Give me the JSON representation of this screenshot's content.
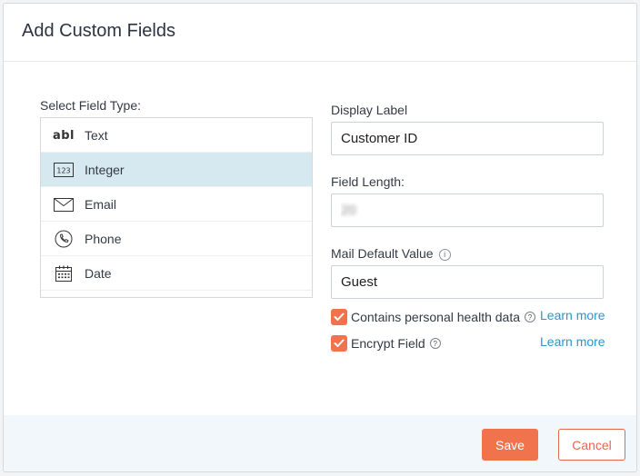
{
  "dialog": {
    "title": "Add Custom Fields"
  },
  "field_types": {
    "label": "Select Field Type:",
    "selected": "Integer",
    "items": [
      {
        "label": "Text",
        "icon": "text-abl-icon"
      },
      {
        "label": "Integer",
        "icon": "integer-123-icon"
      },
      {
        "label": "Email",
        "icon": "envelope-icon"
      },
      {
        "label": "Phone",
        "icon": "phone-icon"
      },
      {
        "label": "Date",
        "icon": "calendar-icon"
      }
    ]
  },
  "form": {
    "display_label": {
      "label": "Display Label",
      "value": "Customer ID"
    },
    "field_length": {
      "label": "Field Length:",
      "value": "20"
    },
    "mail_default": {
      "label": "Mail Default Value",
      "value": "Guest"
    },
    "icon_text": {
      "abl": "abl",
      "int": "123",
      "info": "i",
      "q": "?"
    }
  },
  "options": {
    "health_data": {
      "label": "Contains personal health data",
      "checked": true,
      "link": "Learn more"
    },
    "encrypt": {
      "label": "Encrypt Field",
      "checked": true,
      "link": "Learn more"
    }
  },
  "footer": {
    "save_label": "Save",
    "cancel_label": "Cancel"
  },
  "colors": {
    "accent": "#f0734d",
    "link": "#2b95cc",
    "selected_row": "#d6e8f0",
    "footer_bg": "#f1f7fb"
  }
}
